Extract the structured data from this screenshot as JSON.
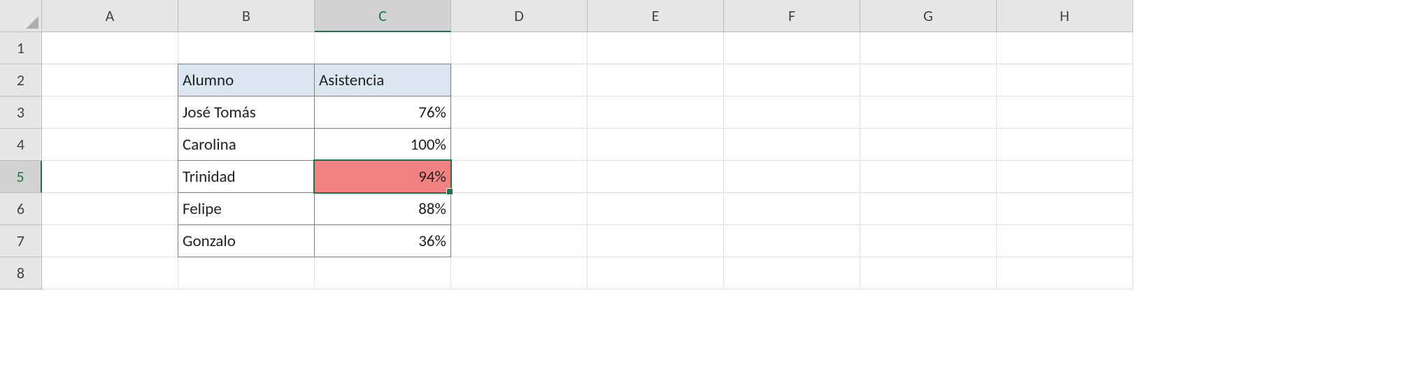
{
  "columns": [
    "A",
    "B",
    "C",
    "D",
    "E",
    "F",
    "G",
    "H"
  ],
  "rows": [
    "1",
    "2",
    "3",
    "4",
    "5",
    "6",
    "7",
    "8"
  ],
  "active_cell": {
    "col": "C",
    "row": "5"
  },
  "table": {
    "headers": {
      "alumno": "Alumno",
      "asistencia": "Asistencia"
    },
    "data": [
      {
        "alumno": "José Tomás",
        "asistencia": "76%"
      },
      {
        "alumno": "Carolina",
        "asistencia": "100%"
      },
      {
        "alumno": "Trinidad",
        "asistencia": "94%"
      },
      {
        "alumno": "Felipe",
        "asistencia": "88%"
      },
      {
        "alumno": "Gonzalo",
        "asistencia": "36%"
      }
    ]
  },
  "colors": {
    "header_fill": "#dce6f1",
    "selection_border": "#217346",
    "highlight_fill": "#f28282"
  }
}
